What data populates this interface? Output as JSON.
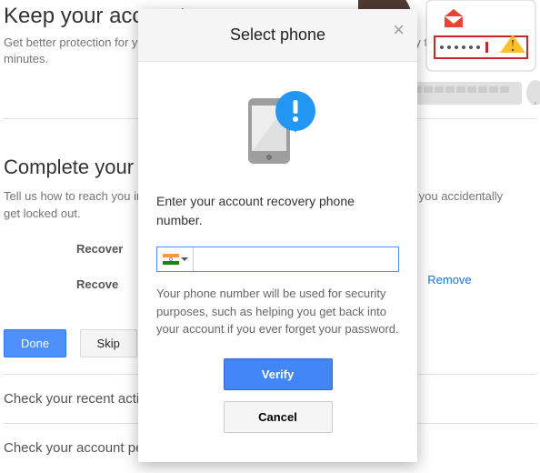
{
  "bg": {
    "heading": "Keep your account secure.",
    "subtext": "Get better protection for your account by reviewing your security settings. It only takes a few minutes.",
    "complete_heading": "Complete your recovery options",
    "complete_desc": "Tell us how to reach you in case we detect unusual activity in your account or if you accidentally get locked out.",
    "row_recover": "Recover",
    "row_recove": "Recove",
    "remove": "Remove",
    "done": "Done",
    "skip": "Skip",
    "activity": "Check your recent activity",
    "permissions": "Check your account permissions"
  },
  "modal": {
    "title": "Select phone",
    "prompt": "Enter your account recovery phone number.",
    "phone_value": "",
    "hint": "Your phone number will be used for security purposes, such as helping you get back into your account if you ever forget your password.",
    "verify": "Verify",
    "cancel": "Cancel",
    "country": "India"
  }
}
